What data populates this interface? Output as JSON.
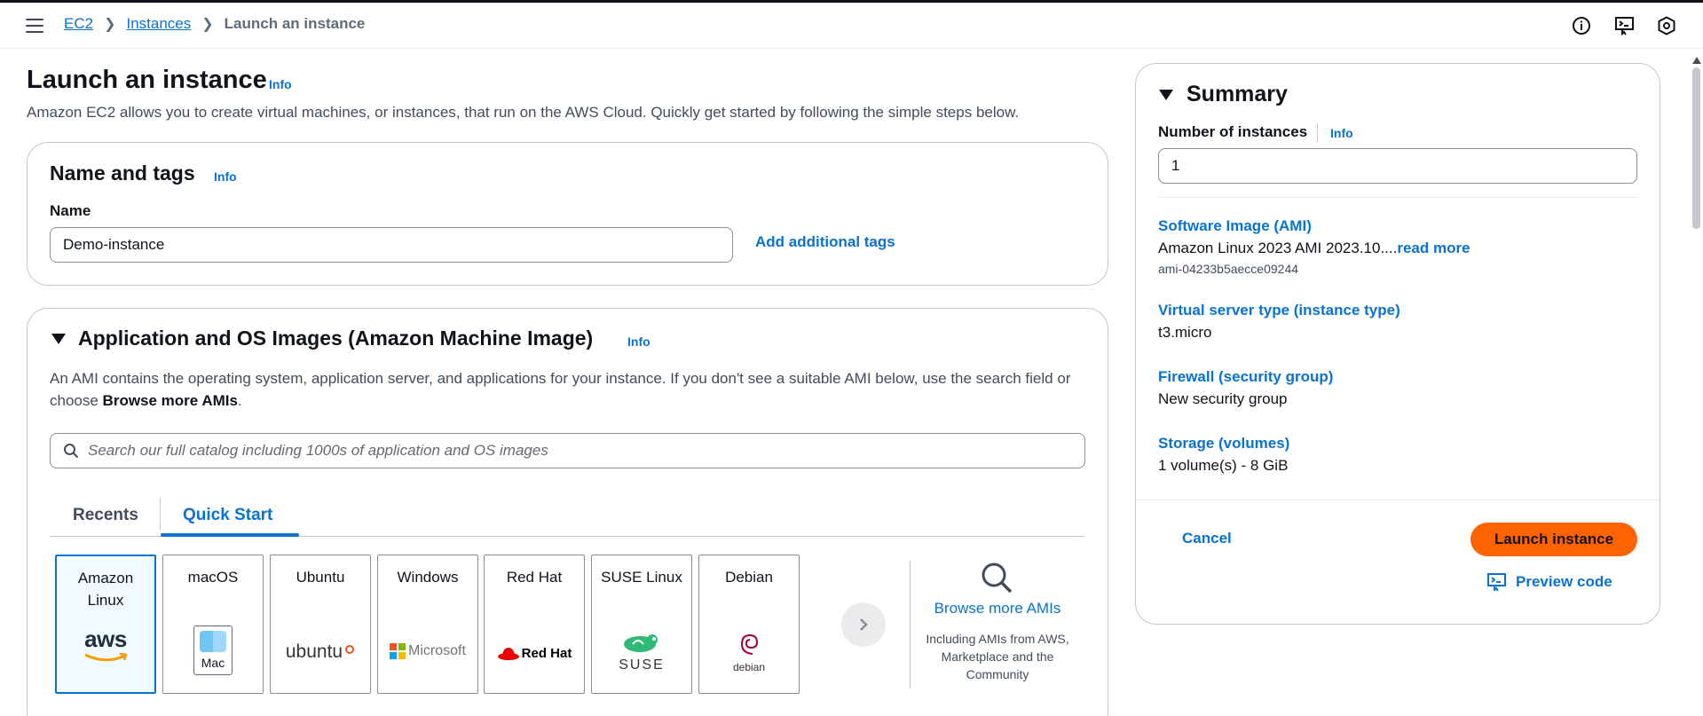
{
  "breadcrumb": {
    "items": [
      "EC2",
      "Instances"
    ],
    "current": "Launch an instance"
  },
  "page": {
    "title": "Launch an instance",
    "info": "Info",
    "description": "Amazon EC2 allows you to create virtual machines, or instances, that run on the AWS Cloud. Quickly get started by following the simple steps below."
  },
  "name_tags": {
    "title": "Name and tags",
    "info": "Info",
    "name_label": "Name",
    "name_value": "Demo-instance",
    "add_tags": "Add additional tags"
  },
  "ami": {
    "title": "Application and OS Images (Amazon Machine Image)",
    "info": "Info",
    "desc_prefix": "An AMI contains the operating system, application server, and applications for your instance. If you don't see a suitable AMI below, use the search field or choose ",
    "desc_bold": "Browse more AMIs",
    "desc_suffix": ".",
    "search_placeholder": "Search our full catalog including 1000s of application and OS images",
    "tabs": [
      "Recents",
      "Quick Start"
    ],
    "active_tab": "Quick Start",
    "tiles": [
      {
        "name": "Amazon Linux",
        "logo": "aws",
        "selected": true
      },
      {
        "name": "macOS",
        "logo": "Mac",
        "selected": false
      },
      {
        "name": "Ubuntu",
        "logo": "ubuntu",
        "selected": false
      },
      {
        "name": "Windows",
        "logo": "Microsoft",
        "selected": false
      },
      {
        "name": "Red Hat",
        "logo": "Red Hat",
        "selected": false
      },
      {
        "name": "SUSE Linux",
        "logo": "SUSE",
        "selected": false
      },
      {
        "name": "Debian",
        "logo": "debian",
        "selected": false
      }
    ],
    "browse_more": "Browse more AMIs",
    "browse_desc": "Including AMIs from AWS, Marketplace and the Community"
  },
  "summary": {
    "title": "Summary",
    "num_label": "Number of instances",
    "info": "Info",
    "num_value": "1",
    "software_image_label": "Software Image (AMI)",
    "software_image_value": "Amazon Linux 2023 AMI 2023.10....",
    "read_more": "read more",
    "ami_id": "ami-04233b5aecce09244",
    "instance_type_label": "Virtual server type (instance type)",
    "instance_type_value": "t3.micro",
    "firewall_label": "Firewall (security group)",
    "firewall_value": "New security group",
    "storage_label": "Storage (volumes)",
    "storage_value": "1 volume(s) - 8 GiB",
    "cancel": "Cancel",
    "launch": "Launch instance",
    "preview": "Preview code"
  },
  "colors": {
    "link": "#0972d3",
    "accent_button": "#ff6200",
    "selected_tile_bg": "#f0fbff"
  }
}
